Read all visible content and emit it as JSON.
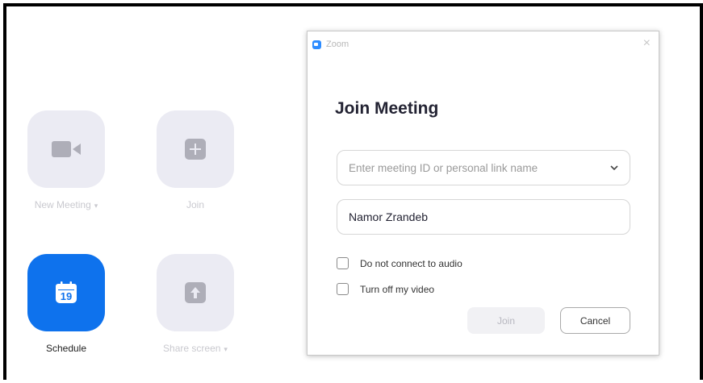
{
  "home": {
    "tiles": [
      {
        "label": "New Meeting",
        "icon": "camera-icon",
        "chevron": "▾"
      },
      {
        "label": "Join",
        "icon": "plus-icon"
      },
      {
        "label": "Schedule",
        "icon": "calendar-icon",
        "calendar_day": "19"
      },
      {
        "label": "Share screen",
        "icon": "share-up-arrow-icon",
        "chevron": "▾"
      }
    ]
  },
  "dialog": {
    "app_title": "Zoom",
    "heading": "Join Meeting",
    "meeting_id_placeholder": "Enter meeting ID or personal link name",
    "name_value": "Namor Zrandeb",
    "checkboxes": [
      {
        "label": "Do not connect to audio",
        "checked": false
      },
      {
        "label": "Turn off my video",
        "checked": false
      }
    ],
    "join_label": "Join",
    "cancel_label": "Cancel",
    "close_glyph": "×",
    "dropdown_glyph": "⌄"
  },
  "colors": {
    "accent": "#0e72ed",
    "tile_bg": "#ebebf3",
    "tile_icon": "#aeaeb8"
  }
}
